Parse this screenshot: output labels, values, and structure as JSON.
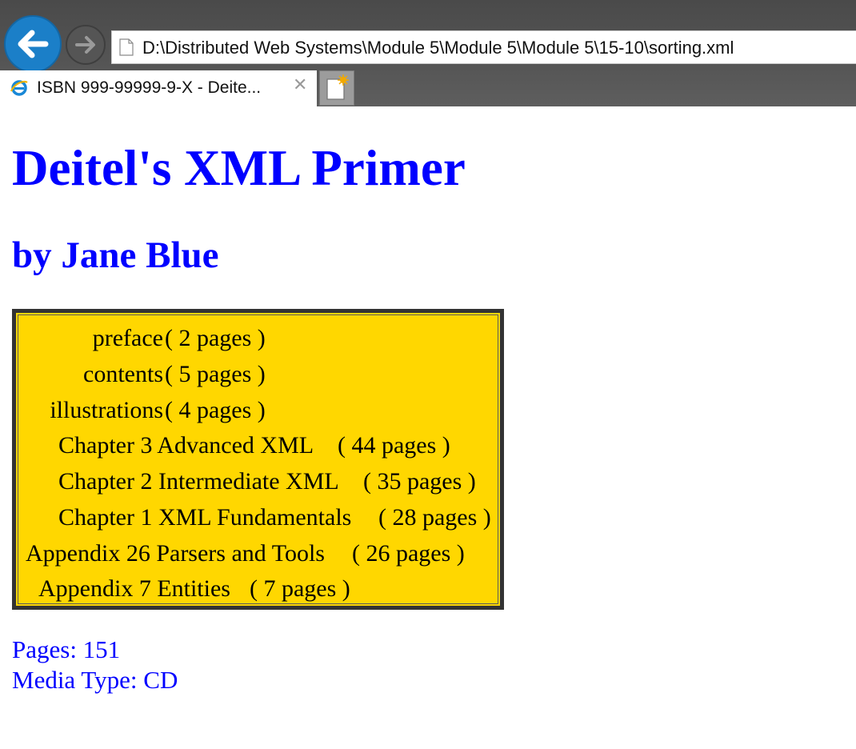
{
  "browser": {
    "address_url": "D:\\Distributed Web Systems\\Module 5\\Module 5\\Module 5\\15-10\\sorting.xml",
    "tab_title": "ISBN 999-99999-9-X - Deite...",
    "tab_close": "✕"
  },
  "page": {
    "title": "Deitel's XML Primer",
    "author": "by Jane Blue",
    "toc": [
      {
        "name": "preface",
        "pages": "( 2 pages )"
      },
      {
        "name": "contents",
        "pages": "( 5 pages )"
      },
      {
        "name": "illustrations",
        "pages": "( 4 pages )"
      },
      {
        "name": "Chapter 3 Advanced XML",
        "pages": "( 44 pages )"
      },
      {
        "name": "Chapter 2 Intermediate XML",
        "pages": "( 35 pages )"
      },
      {
        "name": "Chapter 1 XML Fundamentals",
        "pages": "( 28 pages )"
      },
      {
        "name": "Appendix 26 Parsers and Tools",
        "pages": "( 26 pages )"
      },
      {
        "name": "Appendix 7 Entities",
        "pages": "( 7 pages )"
      }
    ],
    "pages_line": "Pages: 151",
    "media_line": "Media Type: CD"
  },
  "colors": {
    "heading": "#0000ff",
    "toc_background": "#ffd700",
    "back_button": "#1b7fc8"
  },
  "icons": [
    "back-arrow-icon",
    "forward-arrow-icon",
    "page-icon",
    "ie-icon",
    "close-icon",
    "new-tab-icon"
  ]
}
